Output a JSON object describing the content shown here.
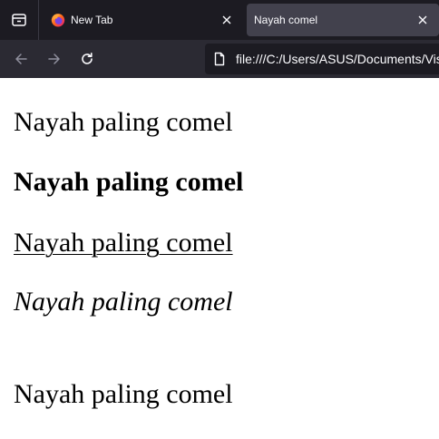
{
  "tabs": [
    {
      "title": "New Tab",
      "favicon": "firefox-icon",
      "active": false
    },
    {
      "title": "Nayah comel",
      "favicon": "",
      "active": true
    }
  ],
  "toolbar": {
    "url": "file:///C:/Users/ASUS/Documents/Visu"
  },
  "page": {
    "lines": [
      "Nayah paling comel",
      "Nayah paling comel",
      "Nayah paling comel",
      "Nayah paling comel",
      "Nayah paling comel"
    ]
  },
  "colors": {
    "tabstrip_bg": "#1c1b22",
    "active_tab_bg": "#42414d",
    "toolbar_bg": "#2b2a33",
    "urlbar_bg": "#1c1b22",
    "text_light": "#fbfbfe",
    "page_bg": "#ffffff"
  }
}
